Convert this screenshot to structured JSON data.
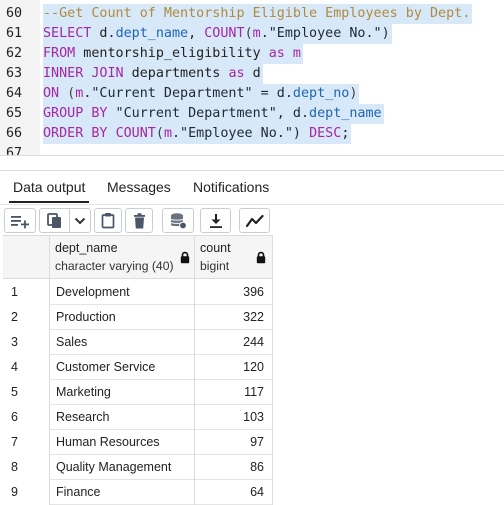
{
  "editor": {
    "lines": [
      {
        "num": "60",
        "tokens": [
          {
            "t": "--Get Count of Mentorship Eligible Employees by Dept.",
            "c": "cm"
          }
        ]
      },
      {
        "num": "61",
        "tokens": [
          {
            "t": "SELECT",
            "c": "kw"
          },
          {
            "t": " d.",
            "c": "tx"
          },
          {
            "t": "dept_name",
            "c": "id"
          },
          {
            "t": ", ",
            "c": "tx"
          },
          {
            "t": "COUNT",
            "c": "fn"
          },
          {
            "t": "(",
            "c": "pn"
          },
          {
            "t": "m",
            "c": "kw"
          },
          {
            "t": ".\"Employee No.\")",
            "c": "st"
          }
        ]
      },
      {
        "num": "62",
        "tokens": [
          {
            "t": "FROM",
            "c": "kw"
          },
          {
            "t": " mentorship_eligibility ",
            "c": "tx"
          },
          {
            "t": "as",
            "c": "kw"
          },
          {
            "t": " ",
            "c": "tx"
          },
          {
            "t": "m",
            "c": "kw"
          }
        ]
      },
      {
        "num": "63",
        "tokens": [
          {
            "t": "INNER JOIN",
            "c": "kw"
          },
          {
            "t": " departments ",
            "c": "tx"
          },
          {
            "t": "as",
            "c": "kw"
          },
          {
            "t": " d",
            "c": "tx"
          }
        ]
      },
      {
        "num": "64",
        "tokens": [
          {
            "t": "ON",
            "c": "kw"
          },
          {
            "t": " (",
            "c": "pn"
          },
          {
            "t": "m",
            "c": "kw"
          },
          {
            "t": ".\"Current Department\" = d.",
            "c": "st"
          },
          {
            "t": "dept_no",
            "c": "id"
          },
          {
            "t": ")",
            "c": "pn"
          }
        ]
      },
      {
        "num": "65",
        "tokens": [
          {
            "t": "GROUP BY",
            "c": "kw"
          },
          {
            "t": " \"Current Department\", d.",
            "c": "st"
          },
          {
            "t": "dept_name",
            "c": "id"
          }
        ]
      },
      {
        "num": "66",
        "tokens": [
          {
            "t": "ORDER BY",
            "c": "kw"
          },
          {
            "t": " ",
            "c": "tx"
          },
          {
            "t": "COUNT",
            "c": "fn"
          },
          {
            "t": "(",
            "c": "pn"
          },
          {
            "t": "m",
            "c": "kw"
          },
          {
            "t": ".\"Employee No.\") ",
            "c": "st"
          },
          {
            "t": "DESC",
            "c": "kw"
          },
          {
            "t": ";",
            "c": "tx"
          }
        ]
      },
      {
        "num": "67",
        "tokens": []
      }
    ]
  },
  "tabs": {
    "data_output": "Data output",
    "messages": "Messages",
    "notifications": "Notifications"
  },
  "toolbar": {
    "buttons": [
      "add-row-icon",
      "copy-icon",
      "chevron-down-icon",
      "paste-icon",
      "delete-icon",
      "database-icon",
      "download-icon",
      "graph-icon"
    ]
  },
  "grid": {
    "columns": [
      {
        "name": "dept_name",
        "type": "character varying (40)"
      },
      {
        "name": "count",
        "type": "bigint"
      }
    ],
    "rows": [
      {
        "idx": "1",
        "dept_name": "Development",
        "count": "396"
      },
      {
        "idx": "2",
        "dept_name": "Production",
        "count": "322"
      },
      {
        "idx": "3",
        "dept_name": "Sales",
        "count": "244"
      },
      {
        "idx": "4",
        "dept_name": "Customer Service",
        "count": "120"
      },
      {
        "idx": "5",
        "dept_name": "Marketing",
        "count": "117"
      },
      {
        "idx": "6",
        "dept_name": "Research",
        "count": "103"
      },
      {
        "idx": "7",
        "dept_name": "Human Resources",
        "count": "97"
      },
      {
        "idx": "8",
        "dept_name": "Quality Management",
        "count": "86"
      },
      {
        "idx": "9",
        "dept_name": "Finance",
        "count": "64"
      }
    ]
  },
  "colors": {
    "selection": "#d7e8f8",
    "keyword": "#a626a4",
    "identifier": "#1f65b2",
    "comment": "#b08a3e"
  }
}
